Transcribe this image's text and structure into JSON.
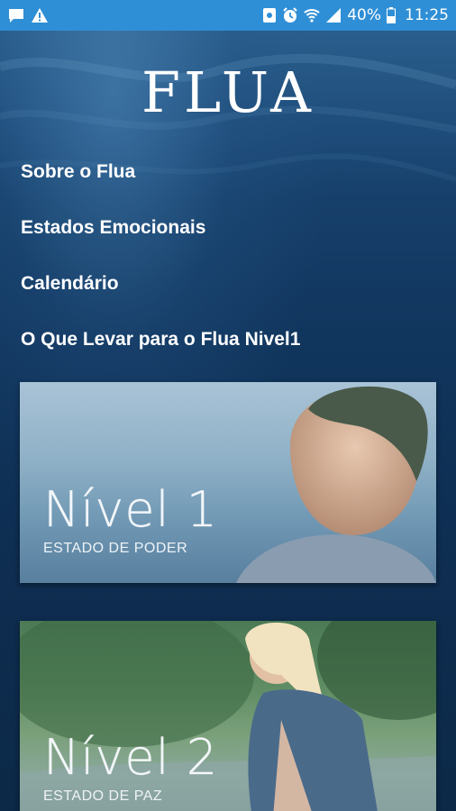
{
  "statusbar": {
    "battery": "40%",
    "time": "11:25",
    "left_icons": [
      "chat-icon",
      "warning-icon"
    ],
    "right_icons": [
      "nfc-icon",
      "alarm-icon",
      "wifi-icon",
      "signal-icon",
      "battery-icon"
    ]
  },
  "app": {
    "logo": "FLUA",
    "menu": [
      {
        "label": "Sobre o Flua"
      },
      {
        "label": "Estados Emocionais"
      },
      {
        "label": "Calendário"
      },
      {
        "label": "O Que Levar para o Flua Nivel1"
      }
    ],
    "cards": [
      {
        "title": "Nível 1",
        "subtitle": "ESTADO DE PODER"
      },
      {
        "title": "Nível 2",
        "subtitle": "ESTADO DE PAZ"
      }
    ]
  },
  "colors": {
    "statusbar": "#2f8fd6",
    "background": "#0e2d50",
    "text": "#ffffff"
  }
}
